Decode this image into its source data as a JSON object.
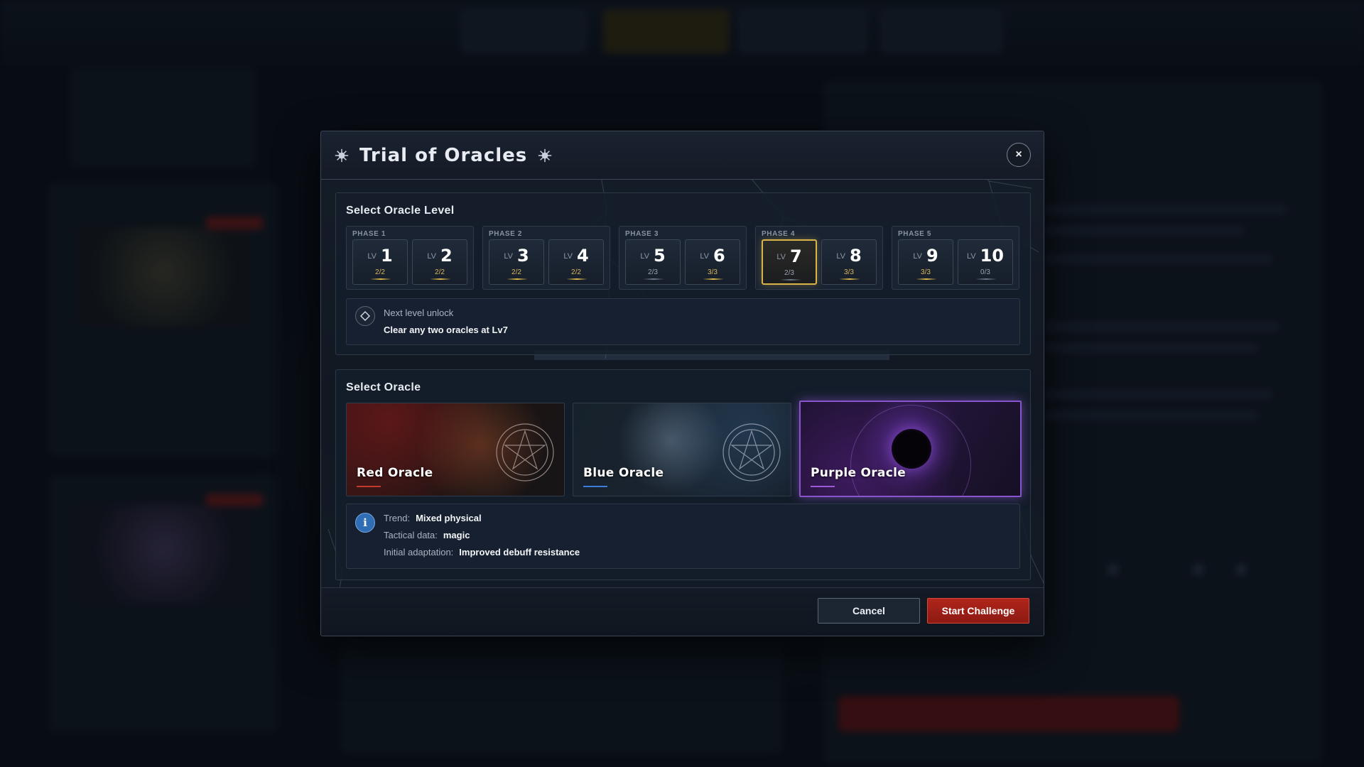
{
  "modal": {
    "title": "Trial of Oracles",
    "close_label": "×"
  },
  "level_section": {
    "label": "Select Oracle Level",
    "lv_prefix": "LV",
    "phases": [
      {
        "label": "PHASE 1",
        "levels": [
          {
            "num": "1",
            "progress": "2/2"
          },
          {
            "num": "2",
            "progress": "2/2"
          }
        ]
      },
      {
        "label": "PHASE 2",
        "levels": [
          {
            "num": "3",
            "progress": "2/2"
          },
          {
            "num": "4",
            "progress": "2/2"
          }
        ]
      },
      {
        "label": "PHASE 3",
        "levels": [
          {
            "num": "5",
            "progress": "2/3"
          },
          {
            "num": "6",
            "progress": "3/3"
          }
        ]
      },
      {
        "label": "PHASE 4",
        "levels": [
          {
            "num": "7",
            "progress": "2/3"
          },
          {
            "num": "8",
            "progress": "3/3"
          }
        ]
      },
      {
        "label": "PHASE 5",
        "levels": [
          {
            "num": "9",
            "progress": "3/3"
          },
          {
            "num": "10",
            "progress": "0/3"
          }
        ]
      }
    ],
    "selected_level": "7",
    "unlock_label": "Next level unlock",
    "unlock_text": "Clear any two oracles at Lv7"
  },
  "oracle_section": {
    "label": "Select Oracle",
    "oracles": [
      {
        "name": "Red Oracle",
        "accent": "#c0392b"
      },
      {
        "name": "Blue Oracle",
        "accent": "#3b7dd8"
      },
      {
        "name": "Purple Oracle",
        "accent": "#9b59d6"
      }
    ],
    "selected_oracle": "Purple Oracle",
    "info": {
      "trend_label": "Trend:",
      "trend_value": "Mixed physical",
      "tactical_label": "Tactical data:",
      "tactical_value": "magic",
      "adaptation_label": "Initial adaptation:",
      "adaptation_value": "Improved debuff resistance"
    }
  },
  "footer": {
    "cancel_label": "Cancel",
    "start_label": "Start Challenge"
  },
  "colors": {
    "gold_accent": "#d8b44a",
    "start_button": "#a82218",
    "selected_oracle_border": "#8a55cc"
  }
}
